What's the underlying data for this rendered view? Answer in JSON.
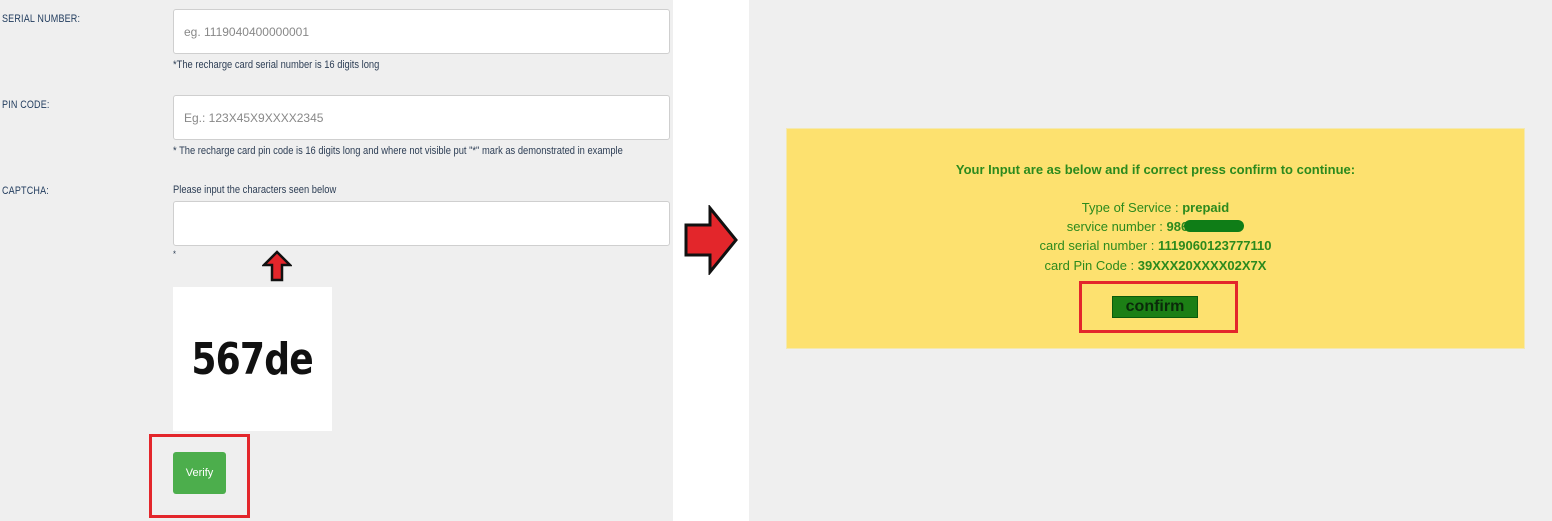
{
  "form": {
    "serial_label": "SERIAL NUMBER:",
    "serial_placeholder": "eg. 1119040400000001",
    "serial_hint": "*The recharge card serial number is 16 digits long",
    "pin_label": "PIN CODE:",
    "pin_placeholder": "Eg.: 123X45X9XXXX2345",
    "pin_hint": "* The recharge card pin code is 16 digits long and where not visible put \"*\" mark as demonstrated in example",
    "captcha_label": "CAPTCHA:",
    "captcha_prompt": "Please input the characters seen below",
    "captcha_value": "",
    "captcha_required_mark": "*",
    "captcha_image_text": "567de",
    "verify_label": "Verify"
  },
  "confirmation": {
    "heading": "Your Input are as below and if correct press confirm to continue:",
    "service_type_label": "Type of Service :",
    "service_type_value": "prepaid",
    "service_number_label": "service number :",
    "service_number_value": "986",
    "card_serial_label": "card serial number :",
    "card_serial_value": "1119060123777110",
    "pin_code_label": "card Pin Code :",
    "pin_code_value": "39XXX20XXXX02X7X",
    "confirm_label": "confirm"
  },
  "colors": {
    "highlight": "#e3262b",
    "verify_button": "#4cae4c",
    "confirm_button": "#1c7f15",
    "card_background": "#fde16f",
    "card_text": "#2c8a1d"
  },
  "icons": [
    "arrow-up-icon",
    "arrow-right-icon"
  ]
}
